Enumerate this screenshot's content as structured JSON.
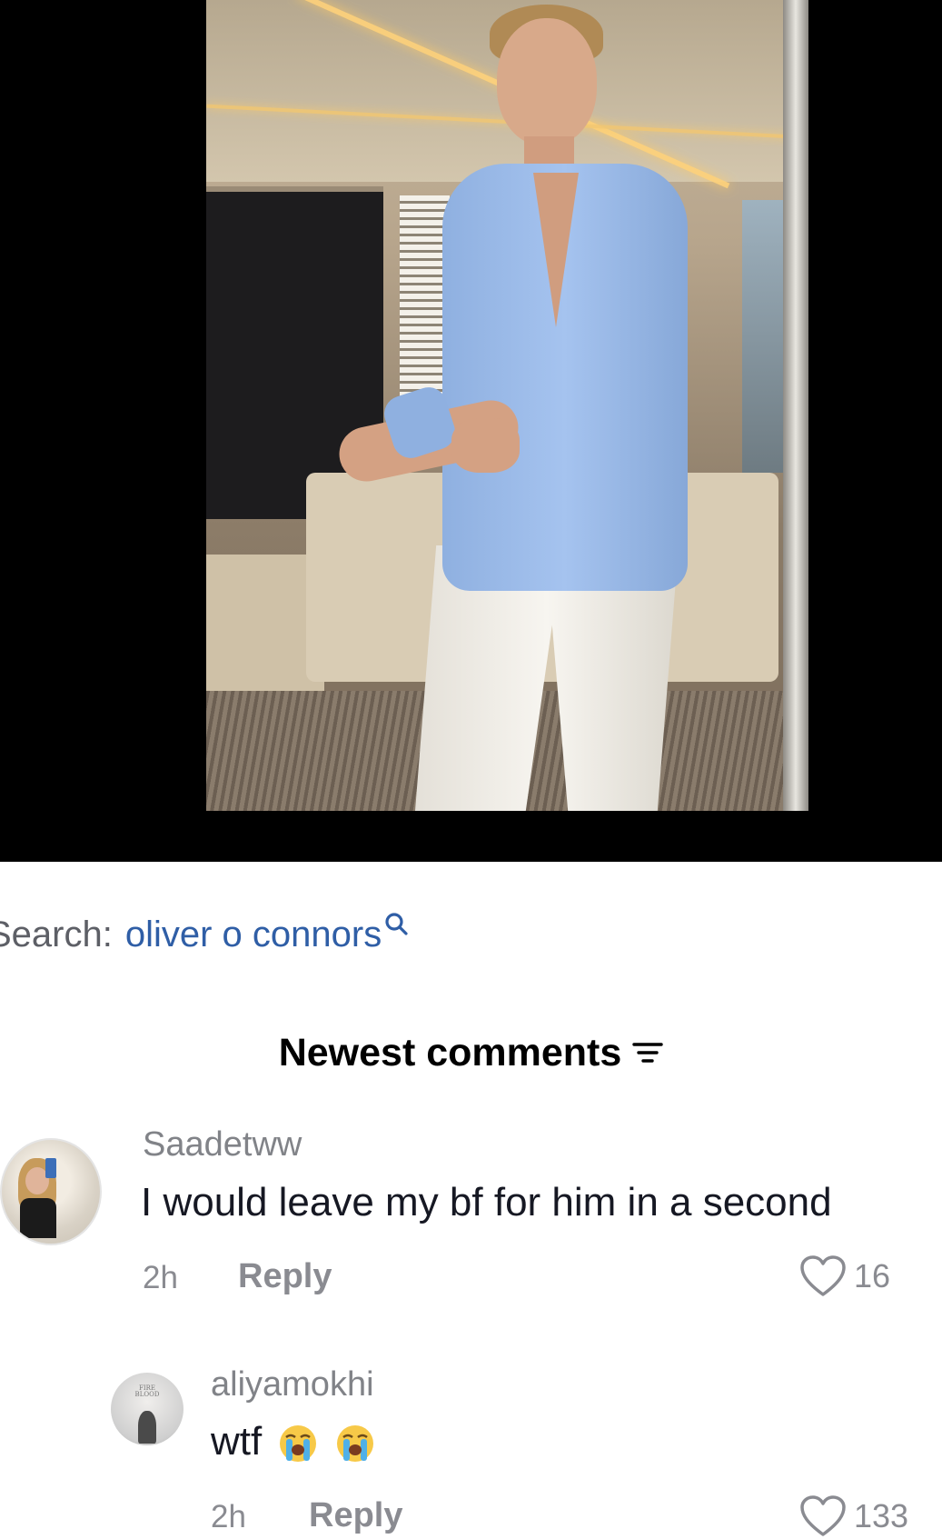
{
  "search": {
    "label": "Search:",
    "query": "oliver o connors"
  },
  "comments_header": {
    "title": "Newest comments"
  },
  "comments": [
    {
      "username": "Saadetww",
      "text": "I would leave my bf for him in a second",
      "time": "2h",
      "reply_label": "Reply",
      "likes": "16"
    },
    {
      "username": "aliyamokhi",
      "text": "wtf",
      "emojis": [
        "loudly-crying-face-icon",
        "loudly-crying-face-icon"
      ],
      "time": "2h",
      "reply_label": "Reply",
      "likes": "133",
      "avatar_text": "FIRE BLOOD"
    }
  ],
  "colors": {
    "search_query": "#2f5ea6",
    "muted_text": "#8a8b91",
    "video_background": "#000000"
  }
}
